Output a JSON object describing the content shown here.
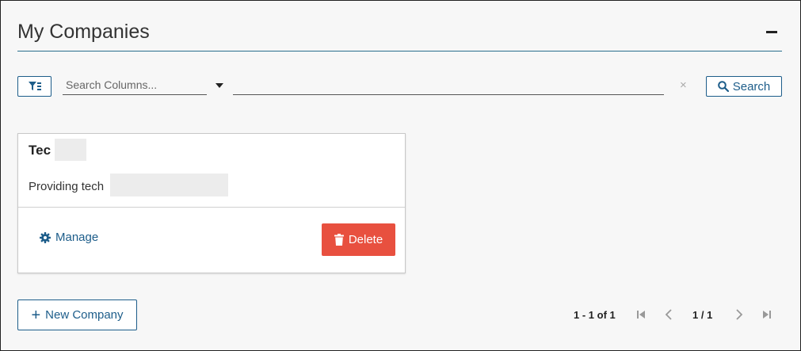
{
  "panel": {
    "title": "My Companies"
  },
  "toolbar": {
    "search_columns_placeholder": "Search Columns...",
    "search_value": "",
    "clear_symbol": "×",
    "search_label": "Search"
  },
  "companies": [
    {
      "name": "Tec",
      "description": "Providing tech",
      "manage_label": "Manage",
      "delete_label": "Delete"
    }
  ],
  "footer": {
    "new_company_label": "New Company",
    "range_text": "1 - 1 of 1",
    "page_text": "1 / 1"
  },
  "icons": {
    "filter": "filter-list-icon",
    "dropdown": "caret-down-icon",
    "search": "search-icon",
    "gear": "gear-icon",
    "trash": "trash-icon",
    "plus": "plus-icon",
    "first": "first-page-icon",
    "prev": "chevron-left-icon",
    "next": "chevron-right-icon",
    "last": "last-page-icon"
  },
  "colors": {
    "accent": "#1d5d8a",
    "danger": "#e8503f",
    "header_rule": "#2a6f8e"
  }
}
